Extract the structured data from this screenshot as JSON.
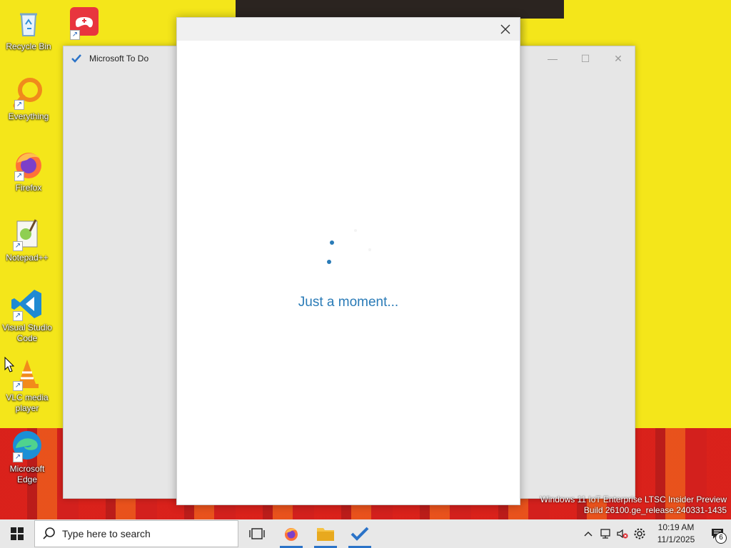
{
  "desktop": {
    "icons": [
      {
        "label": "Recycle Bin"
      },
      {
        "label": "Everything"
      },
      {
        "label": "Firefox"
      },
      {
        "label": "Notepad++"
      },
      {
        "label": "Visual Studio Code"
      },
      {
        "label": "VLC media player"
      },
      {
        "label": "Microsoft Edge"
      }
    ]
  },
  "todo_window": {
    "title": "Microsoft To Do",
    "minimize": "—",
    "maximize": "☐",
    "close": "✕"
  },
  "dialog": {
    "loading_text": "Just a moment..."
  },
  "watermark": {
    "line1": "Windows 11 IoT Enterprise LTSC Insider Preview",
    "line2": "Build 26100.ge_release.240331-1435"
  },
  "taskbar": {
    "search_placeholder": "Type here to search",
    "time": "10:19 AM",
    "date": "11/1/2025",
    "notification_count": "6"
  },
  "colors": {
    "accent": "#2b73c8",
    "loading_text": "#2a7bb7"
  }
}
